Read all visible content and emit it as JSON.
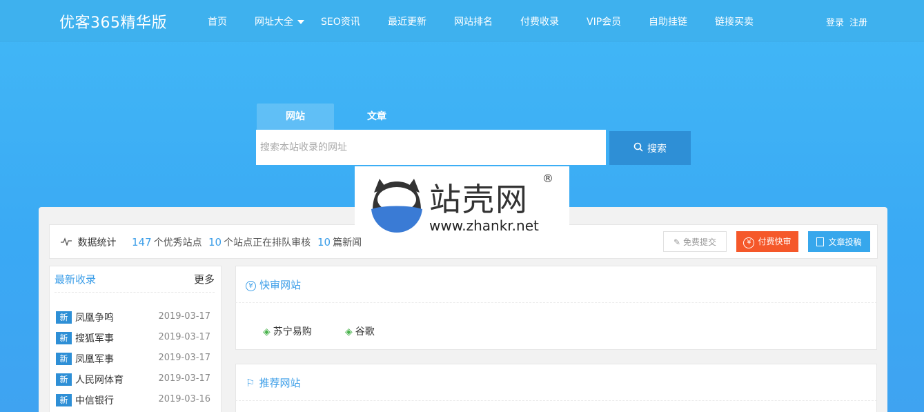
{
  "header": {
    "brand": "优客365精华版",
    "nav": [
      "首页",
      "网址大全",
      "SEO资讯",
      "最近更新",
      "网站排名",
      "付费收录",
      "VIP会员",
      "自助挂链",
      "链接买卖"
    ],
    "login": "登录",
    "register": "注册"
  },
  "search": {
    "tabs": [
      "网站",
      "文章"
    ],
    "placeholder": "搜索本站收录的网址",
    "button": "搜索"
  },
  "watermark": {
    "name": "站壳网",
    "url": "www.zhankr.net",
    "reg": "®"
  },
  "stats": {
    "label": "数据统计",
    "items": [
      {
        "num": "147",
        "text": "个优秀站点"
      },
      {
        "num": "10",
        "text": "个站点正在排队审核"
      },
      {
        "num": "10",
        "text": "篇新闻"
      }
    ],
    "buttons": {
      "free": "免费提交",
      "paid": "付费快审",
      "article": "文章投稿"
    }
  },
  "latest": {
    "title": "最新收录",
    "more": "更多",
    "badge": "新",
    "rows": [
      {
        "name": "凤凰争鸣",
        "date": "2019-03-17"
      },
      {
        "name": "搜狐军事",
        "date": "2019-03-17"
      },
      {
        "name": "凤凰军事",
        "date": "2019-03-17"
      },
      {
        "name": "人民网体育",
        "date": "2019-03-17"
      },
      {
        "name": "中信银行",
        "date": "2019-03-16"
      }
    ]
  },
  "fast": {
    "title": "快审网站",
    "sites": [
      "苏宁易购",
      "谷歌"
    ]
  },
  "recommend": {
    "title": "推荐网站"
  },
  "colors": {
    "accent": "#3a9de8",
    "paid_button": "#f5582a",
    "article_button": "#37a7ec",
    "search_button": "#2e8fd6"
  }
}
